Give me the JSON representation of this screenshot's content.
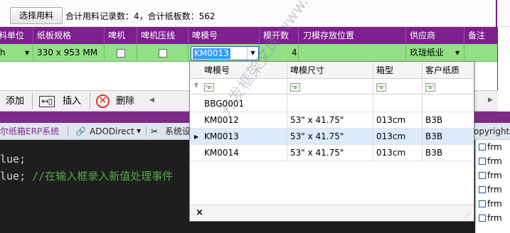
{
  "toolbar": {
    "select_button": "选择用料",
    "summary": "合计用料记录数：4，合计纸板数：562"
  },
  "grid": {
    "columns": [
      "料单位",
      "纸板规格",
      "啤机",
      "啤机压线",
      "啤模号",
      "模开数",
      "刀模存放位置",
      "供应商",
      "备注"
    ],
    "row": {
      "unit": "h",
      "board_spec": "330 x 953 MM",
      "mold_no": "KM0013",
      "mold_count": "4",
      "supplier": "玖珑纸业"
    }
  },
  "actions": {
    "add": "添加",
    "insert": "插入",
    "delete": "删除"
  },
  "ide": {
    "items": [
      "尔纸箱ERP系统",
      "ADODirect",
      "系统设",
      "opyrights"
    ]
  },
  "code": {
    "line1": "lue;",
    "line2_code": "lue;",
    "line2_comment": "//在输入框录入新值处理事件"
  },
  "solution": {
    "items": [
      "frm",
      "frm",
      "frm",
      "frm",
      "frm",
      "frm",
      "frm"
    ]
  },
  "dropdown": {
    "columns": [
      "啤模号",
      "啤模尺寸",
      "箱型",
      "客户纸质"
    ],
    "rows": [
      {
        "mold": "BBG0001",
        "size": "",
        "box": "",
        "paper": ""
      },
      {
        "mold": "KM0012",
        "size": "53\" x 41.75\"",
        "box": "013cm",
        "paper": "B3B"
      },
      {
        "mold": "KM0013",
        "size": "53\" x 41.75\"",
        "box": "013cm",
        "paper": "B3B"
      },
      {
        "mold": "KM0014",
        "size": "53\" x 41.75\"",
        "box": "013cm",
        "paper": "B3B"
      }
    ],
    "selected_index": 2,
    "close_label": "×"
  },
  "watermark": "开发框架文库 www.code.net",
  "colors": {
    "header_bg": "#7d1f8e",
    "selected_row_bg": "#92e085",
    "active_popup_row": "#dcebfc",
    "code_bg": "#1e1e1e",
    "comment": "#57a64a"
  },
  "icons": {
    "delete": "delete-circle-x-icon",
    "insert": "insert-row-icon",
    "add": "add-icon",
    "ado": "chain-link-icon",
    "settings": "wrench-icon",
    "filter": "abc-filter-icon",
    "pin": "pin-icon"
  }
}
